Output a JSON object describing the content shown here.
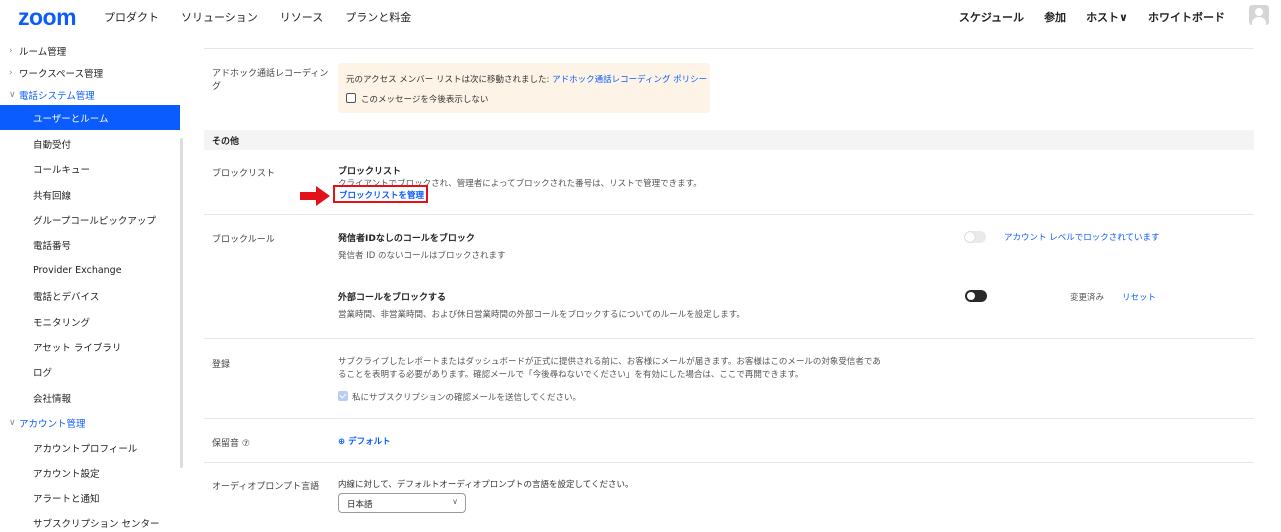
{
  "topbar": {
    "logo": "zoom",
    "nav": [
      "プロダクト",
      "ソリューション",
      "リソース",
      "プランと料金"
    ],
    "right": [
      "スケジュール",
      "参加",
      "ホスト∨",
      "ホワイトボード"
    ]
  },
  "sidebar": {
    "items": [
      {
        "label": "ルーム管理",
        "chev": "›"
      },
      {
        "label": "ワークスペース管理",
        "chev": "›"
      },
      {
        "label": "電話システム管理",
        "chev": "∨"
      },
      {
        "label": "ユーザーとルーム"
      },
      {
        "label": "自動受付"
      },
      {
        "label": "コールキュー"
      },
      {
        "label": "共有回線"
      },
      {
        "label": "グループコールピックアップ"
      },
      {
        "label": "電話番号"
      },
      {
        "label": "Provider Exchange"
      },
      {
        "label": "電話とデバイス"
      },
      {
        "label": "モニタリング"
      },
      {
        "label": "アセット ライブラリ"
      },
      {
        "label": "ログ"
      },
      {
        "label": "会社情報"
      },
      {
        "label": "アカウント管理",
        "chev": "∨"
      },
      {
        "label": "アカウントプロフィール"
      },
      {
        "label": "アカウント設定"
      },
      {
        "label": "アラートと通知"
      },
      {
        "label": "サブスクリプション センター"
      }
    ]
  },
  "adhoc": {
    "label": "アドホック通話レコーディング",
    "notice_text": "元のアクセス メンバー リストは次に移動されました: ",
    "notice_link": "アドホック通話レコーディング ポリシー",
    "checkbox_label": "このメッセージを今後表示しない"
  },
  "other": {
    "header": "その他",
    "blocklist": {
      "label": "ブロックリスト",
      "title": "ブロックリスト",
      "desc": "クライアントでブロックされ、管理者によってブロックされた番号は、リストで管理できます。",
      "link": "ブロックリストを管理"
    },
    "blockrule": {
      "label": "ブロックルール",
      "r1_title": "発信者IDなしのコールをブロック",
      "r1_desc": "発信者 ID のないコールはブロックされます",
      "r1_status": "アカウント レベルでロックされています",
      "r2_title": "外部コールをブロックする",
      "r2_desc": "営業時間、非営業時間、および休日営業時間の外部コールをブロックするについてのルールを設定します。",
      "r2_modified": "変更済み",
      "r2_reset": "リセット"
    },
    "register": {
      "label": "登録",
      "desc1": "サブクライブしたレポートまたはダッシュボードが正式に提供される前に、お客様にメールが届きます。お客様はこのメールの対象受信者であ",
      "desc2": "ることを表明する必要があります。確認メールで「今後尋ねないでください」を有効にした場合は、ここで再開できます。",
      "checkbox_label": "私にサブスクリプションの確認メールを送信してください。"
    },
    "hold": {
      "label": "保留音 ⑦",
      "value": "⊕ デフォルト"
    },
    "audio": {
      "label": "オーディオプロンプト言語",
      "desc": "内線に対して、デフォルトオーディオプロンプトの言語を設定してください。",
      "selected": "日本語"
    }
  },
  "colors": {
    "accent": "#0b5cff",
    "highlight": "#e4101a",
    "notice_bg": "#fdf3e6"
  }
}
